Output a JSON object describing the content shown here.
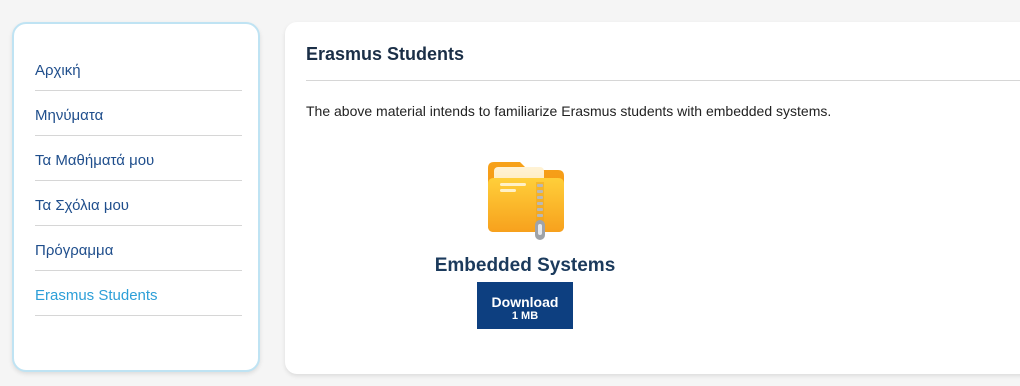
{
  "sidebar": {
    "items": [
      {
        "label": "Αρχική"
      },
      {
        "label": "Μηνύματα"
      },
      {
        "label": "Τα Μαθήματά μου"
      },
      {
        "label": "Τα Σχόλια μου"
      },
      {
        "label": "Πρόγραμμα"
      },
      {
        "label": "Erasmus Students",
        "active": true
      }
    ]
  },
  "main": {
    "title": "Erasmus Students",
    "description": "The above material intends to familiarize Erasmus students with embedded systems.",
    "file": {
      "name": "Embedded Systems",
      "icon": "zip-folder-icon",
      "download_label": "Download",
      "size": "1 MB"
    }
  },
  "colors": {
    "link": "#1f4e8c",
    "active_link": "#2d9fd8",
    "download_button": "#0d3f80",
    "sidebar_border": "#bfe3f3"
  }
}
